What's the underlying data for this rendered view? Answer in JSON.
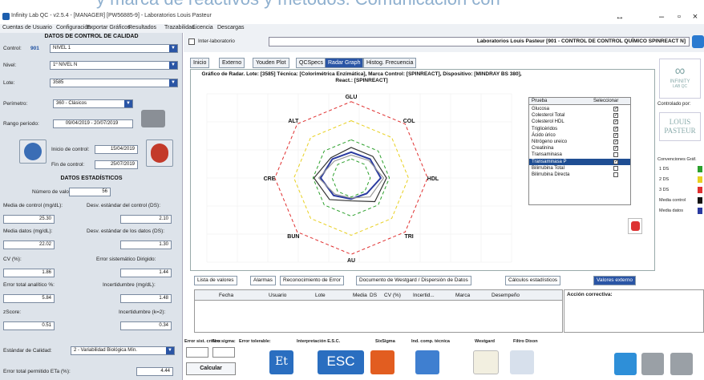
{
  "banner": {
    "text": "y marca de reactivos y métodos. Comunicación con"
  },
  "window": {
    "title": "Infinity Lab QC - v2.5.4 - [MANAGER] [PW56885-9] - Laboratorios Louis Pasteur",
    "minimize": "–",
    "maximize": "▫",
    "close": "×",
    "extra": "↔"
  },
  "menu": [
    "Cuentas de Usuario",
    "Configuración",
    "Exportar Gráficos",
    "Resultados",
    "Trazabilidad",
    "Licencia",
    "Descargas"
  ],
  "left": {
    "header": "DATOS DE CONTROL DE CALIDAD",
    "control_label": "Control:",
    "control_code": "901",
    "control_value": "NIVEL 1",
    "nivel_label": "Nivel:",
    "nivel_value": "1º NIVEL N",
    "lote_label": "Lote:",
    "lote_value": "3585",
    "perimetro_label": "Perímetro:",
    "perimetro_value": "360 - Clásicos",
    "rango_label": "Rango período:",
    "rango_value": "09/04/2019 - 20/07/2019",
    "inicio_label": "Inicio de control:",
    "inicio_value": "15/04/2019",
    "fin_label": "Fin de control:",
    "fin_value": "25/07/2019",
    "stats_header": "DATOS ESTADÍSTICOS",
    "n_label": "Número de valores:",
    "n_value": "56",
    "mean_ctrl_label": "Media de control (mg/dL):",
    "mean_ctrl_value": "25.30",
    "sd_ctrl_label": "Desv. estándar del control (DS):",
    "sd_ctrl_value": "2.10",
    "mean_lab_label": "Media datos (mg/dL):",
    "mean_lab_value": "22.02",
    "sd_lab_label": "Desv. estándar de los datos (DS):",
    "sd_lab_value": "1.30",
    "cv_label": "CV (%):",
    "cv_value": "1.86",
    "cv_lab_label": "Error sistemático Dirigido:",
    "cv_lab_value": "1.44",
    "err_label": "Error total analítico %:",
    "err_value": "5.84",
    "err2_label": "Incertidumbre (mg/dL):",
    "err2_value": "1.48",
    "zscore_label": "zScore:",
    "zscore_value": "0.51",
    "inc_label": "Incertidumbre (k=2):",
    "inc_value": "0.34",
    "esp_label": "Estándar de Calidad:",
    "esp_value": "2 - Variabilidad Biológica Mín.",
    "esp2_label": "Error total permitido ETa (%):",
    "esp2_value": "4.44"
  },
  "topbar": {
    "checkbox_label": "Inter-laboratorio",
    "lab_title": "Laboratorios Louis Pasteur [901 - CONTROL DE CONTROL QUÍMICO SPINREACT N]"
  },
  "tabs": [
    "Inicio",
    "Externo",
    "Youden Plot",
    "QCSpecs",
    "Radar Graph",
    "Histog. Frecuencia"
  ],
  "chart_data": {
    "type": "radar",
    "title": "Gráfico de Radar. Lote: [3585] Técnica: [Colorimétrica Enzimática], Marca Control: [SPINREACT], Dispositivo: [MINDRAY BS 380], React.: [SPINREACT]",
    "axes": [
      "GLU",
      "COL",
      "HDL",
      "TRI",
      "AU",
      "BUN",
      "CRE",
      "ALT"
    ],
    "reference_rings": [
      {
        "level": 1,
        "color": "#2ca02c"
      },
      {
        "level": 2,
        "color": "#2ca02c"
      },
      {
        "level": 3,
        "color": "#e8d020"
      },
      {
        "level": 4,
        "color": "#e03030"
      }
    ],
    "series": [
      {
        "color": "#2a3aa0",
        "values": [
          1.35,
          1.4,
          1.55,
          1.15,
          1.1,
          1.3,
          1.6,
          1.4
        ]
      },
      {
        "color": "#333333",
        "values": [
          1.6,
          1.6,
          1.85,
          1.75,
          1.2,
          1.6,
          1.95,
          1.5
        ]
      },
      {
        "color": "#999999",
        "values": [
          1.2,
          1.3,
          1.7,
          1.4,
          1.05,
          1.2,
          1.7,
          1.25
        ]
      }
    ],
    "rmax": 4.2
  },
  "tests": {
    "col_prueba": "Prueba",
    "col_sel": "Seleccionar",
    "rows": [
      {
        "name": "Glucosa",
        "checked": true,
        "selected": false
      },
      {
        "name": "Colesterol Total",
        "checked": true,
        "selected": false
      },
      {
        "name": "Colesterol HDL",
        "checked": true,
        "selected": false
      },
      {
        "name": "Triglicéridos",
        "checked": true,
        "selected": false
      },
      {
        "name": "Ácido úrico",
        "checked": true,
        "selected": false
      },
      {
        "name": "Nitrógeno ureico",
        "checked": true,
        "selected": false
      },
      {
        "name": "Creatinina",
        "checked": true,
        "selected": false
      },
      {
        "name": "Transaminasa",
        "checked": false,
        "selected": false
      },
      {
        "name": "Transaminasa P",
        "checked": true,
        "selected": true
      },
      {
        "name": "Bilirrubina Total",
        "checked": false,
        "selected": false
      },
      {
        "name": "Bilirrubina Directa",
        "checked": false,
        "selected": false
      }
    ]
  },
  "right": {
    "logo_text": "INFINITY",
    "logo_sub": "LAB QC",
    "powered": "Controlado por:",
    "brand": "LOUIS PASTEUR",
    "legend_title": "Convenciones Gráf.",
    "legend": [
      {
        "label": "1 DS",
        "color": "#2ca02c"
      },
      {
        "label": "2 DS",
        "color": "#e8d020"
      },
      {
        "label": "3 DS",
        "color": "#e03030"
      },
      {
        "label": "Media control",
        "color": "#111111"
      },
      {
        "label": "Media datos",
        "color": "#2a3aa0"
      }
    ]
  },
  "bottom_tabs": [
    "Lista de valores",
    "Alarmas",
    "Reconocimiento de Error",
    "Documento de Westgard / Dispersión de Datos",
    "Cálculos estadísticos",
    "Valores externo"
  ],
  "grid_cols": [
    "Fecha",
    "Usuario",
    "Lote",
    "Media",
    "DS",
    "CV (%)",
    "Incertid...",
    "Marca",
    "Desempeño"
  ],
  "corr_label": "Acción correctiva:",
  "tools": {
    "err_sist": "Error sist. crítico:",
    "sigma": "Nro sigma:",
    "err_tol": "Error tolerable:",
    "interp": "Interpretación E.S.C.",
    "sixsigma": "SixSigma",
    "ind_comp": "Ind. comp. técnica",
    "westgard": "Westgard",
    "filtro": "Filtro Dixon",
    "calc": "Calcular",
    "et_icon": "Et",
    "esc_icon": "ESC"
  }
}
